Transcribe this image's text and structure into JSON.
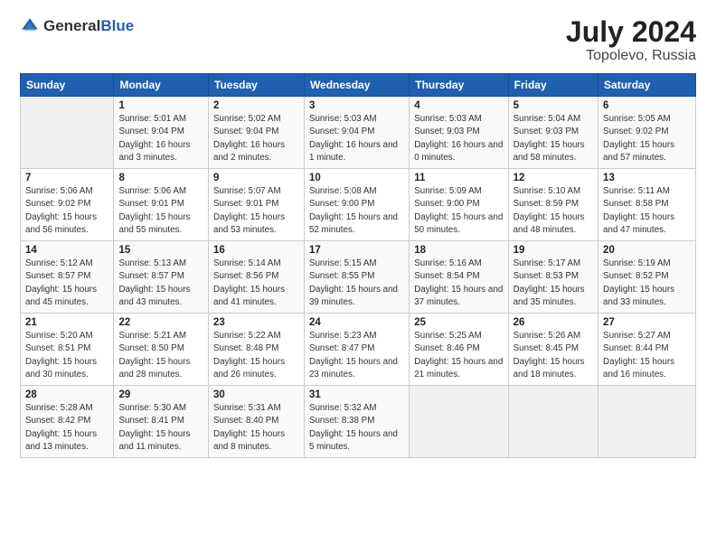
{
  "header": {
    "logo_general": "General",
    "logo_blue": "Blue",
    "title": "July 2024",
    "subtitle": "Topolevo, Russia"
  },
  "columns": [
    "Sunday",
    "Monday",
    "Tuesday",
    "Wednesday",
    "Thursday",
    "Friday",
    "Saturday"
  ],
  "weeks": [
    [
      {
        "date": "",
        "sunrise": "",
        "sunset": "",
        "daylight": ""
      },
      {
        "date": "1",
        "sunrise": "Sunrise: 5:01 AM",
        "sunset": "Sunset: 9:04 PM",
        "daylight": "Daylight: 16 hours and 3 minutes."
      },
      {
        "date": "2",
        "sunrise": "Sunrise: 5:02 AM",
        "sunset": "Sunset: 9:04 PM",
        "daylight": "Daylight: 16 hours and 2 minutes."
      },
      {
        "date": "3",
        "sunrise": "Sunrise: 5:03 AM",
        "sunset": "Sunset: 9:04 PM",
        "daylight": "Daylight: 16 hours and 1 minute."
      },
      {
        "date": "4",
        "sunrise": "Sunrise: 5:03 AM",
        "sunset": "Sunset: 9:03 PM",
        "daylight": "Daylight: 16 hours and 0 minutes."
      },
      {
        "date": "5",
        "sunrise": "Sunrise: 5:04 AM",
        "sunset": "Sunset: 9:03 PM",
        "daylight": "Daylight: 15 hours and 58 minutes."
      },
      {
        "date": "6",
        "sunrise": "Sunrise: 5:05 AM",
        "sunset": "Sunset: 9:02 PM",
        "daylight": "Daylight: 15 hours and 57 minutes."
      }
    ],
    [
      {
        "date": "7",
        "sunrise": "Sunrise: 5:06 AM",
        "sunset": "Sunset: 9:02 PM",
        "daylight": "Daylight: 15 hours and 56 minutes."
      },
      {
        "date": "8",
        "sunrise": "Sunrise: 5:06 AM",
        "sunset": "Sunset: 9:01 PM",
        "daylight": "Daylight: 15 hours and 55 minutes."
      },
      {
        "date": "9",
        "sunrise": "Sunrise: 5:07 AM",
        "sunset": "Sunset: 9:01 PM",
        "daylight": "Daylight: 15 hours and 53 minutes."
      },
      {
        "date": "10",
        "sunrise": "Sunrise: 5:08 AM",
        "sunset": "Sunset: 9:00 PM",
        "daylight": "Daylight: 15 hours and 52 minutes."
      },
      {
        "date": "11",
        "sunrise": "Sunrise: 5:09 AM",
        "sunset": "Sunset: 9:00 PM",
        "daylight": "Daylight: 15 hours and 50 minutes."
      },
      {
        "date": "12",
        "sunrise": "Sunrise: 5:10 AM",
        "sunset": "Sunset: 8:59 PM",
        "daylight": "Daylight: 15 hours and 48 minutes."
      },
      {
        "date": "13",
        "sunrise": "Sunrise: 5:11 AM",
        "sunset": "Sunset: 8:58 PM",
        "daylight": "Daylight: 15 hours and 47 minutes."
      }
    ],
    [
      {
        "date": "14",
        "sunrise": "Sunrise: 5:12 AM",
        "sunset": "Sunset: 8:57 PM",
        "daylight": "Daylight: 15 hours and 45 minutes."
      },
      {
        "date": "15",
        "sunrise": "Sunrise: 5:13 AM",
        "sunset": "Sunset: 8:57 PM",
        "daylight": "Daylight: 15 hours and 43 minutes."
      },
      {
        "date": "16",
        "sunrise": "Sunrise: 5:14 AM",
        "sunset": "Sunset: 8:56 PM",
        "daylight": "Daylight: 15 hours and 41 minutes."
      },
      {
        "date": "17",
        "sunrise": "Sunrise: 5:15 AM",
        "sunset": "Sunset: 8:55 PM",
        "daylight": "Daylight: 15 hours and 39 minutes."
      },
      {
        "date": "18",
        "sunrise": "Sunrise: 5:16 AM",
        "sunset": "Sunset: 8:54 PM",
        "daylight": "Daylight: 15 hours and 37 minutes."
      },
      {
        "date": "19",
        "sunrise": "Sunrise: 5:17 AM",
        "sunset": "Sunset: 8:53 PM",
        "daylight": "Daylight: 15 hours and 35 minutes."
      },
      {
        "date": "20",
        "sunrise": "Sunrise: 5:19 AM",
        "sunset": "Sunset: 8:52 PM",
        "daylight": "Daylight: 15 hours and 33 minutes."
      }
    ],
    [
      {
        "date": "21",
        "sunrise": "Sunrise: 5:20 AM",
        "sunset": "Sunset: 8:51 PM",
        "daylight": "Daylight: 15 hours and 30 minutes."
      },
      {
        "date": "22",
        "sunrise": "Sunrise: 5:21 AM",
        "sunset": "Sunset: 8:50 PM",
        "daylight": "Daylight: 15 hours and 28 minutes."
      },
      {
        "date": "23",
        "sunrise": "Sunrise: 5:22 AM",
        "sunset": "Sunset: 8:48 PM",
        "daylight": "Daylight: 15 hours and 26 minutes."
      },
      {
        "date": "24",
        "sunrise": "Sunrise: 5:23 AM",
        "sunset": "Sunset: 8:47 PM",
        "daylight": "Daylight: 15 hours and 23 minutes."
      },
      {
        "date": "25",
        "sunrise": "Sunrise: 5:25 AM",
        "sunset": "Sunset: 8:46 PM",
        "daylight": "Daylight: 15 hours and 21 minutes."
      },
      {
        "date": "26",
        "sunrise": "Sunrise: 5:26 AM",
        "sunset": "Sunset: 8:45 PM",
        "daylight": "Daylight: 15 hours and 18 minutes."
      },
      {
        "date": "27",
        "sunrise": "Sunrise: 5:27 AM",
        "sunset": "Sunset: 8:44 PM",
        "daylight": "Daylight: 15 hours and 16 minutes."
      }
    ],
    [
      {
        "date": "28",
        "sunrise": "Sunrise: 5:28 AM",
        "sunset": "Sunset: 8:42 PM",
        "daylight": "Daylight: 15 hours and 13 minutes."
      },
      {
        "date": "29",
        "sunrise": "Sunrise: 5:30 AM",
        "sunset": "Sunset: 8:41 PM",
        "daylight": "Daylight: 15 hours and 11 minutes."
      },
      {
        "date": "30",
        "sunrise": "Sunrise: 5:31 AM",
        "sunset": "Sunset: 8:40 PM",
        "daylight": "Daylight: 15 hours and 8 minutes."
      },
      {
        "date": "31",
        "sunrise": "Sunrise: 5:32 AM",
        "sunset": "Sunset: 8:38 PM",
        "daylight": "Daylight: 15 hours and 5 minutes."
      },
      {
        "date": "",
        "sunrise": "",
        "sunset": "",
        "daylight": ""
      },
      {
        "date": "",
        "sunrise": "",
        "sunset": "",
        "daylight": ""
      },
      {
        "date": "",
        "sunrise": "",
        "sunset": "",
        "daylight": ""
      }
    ]
  ]
}
